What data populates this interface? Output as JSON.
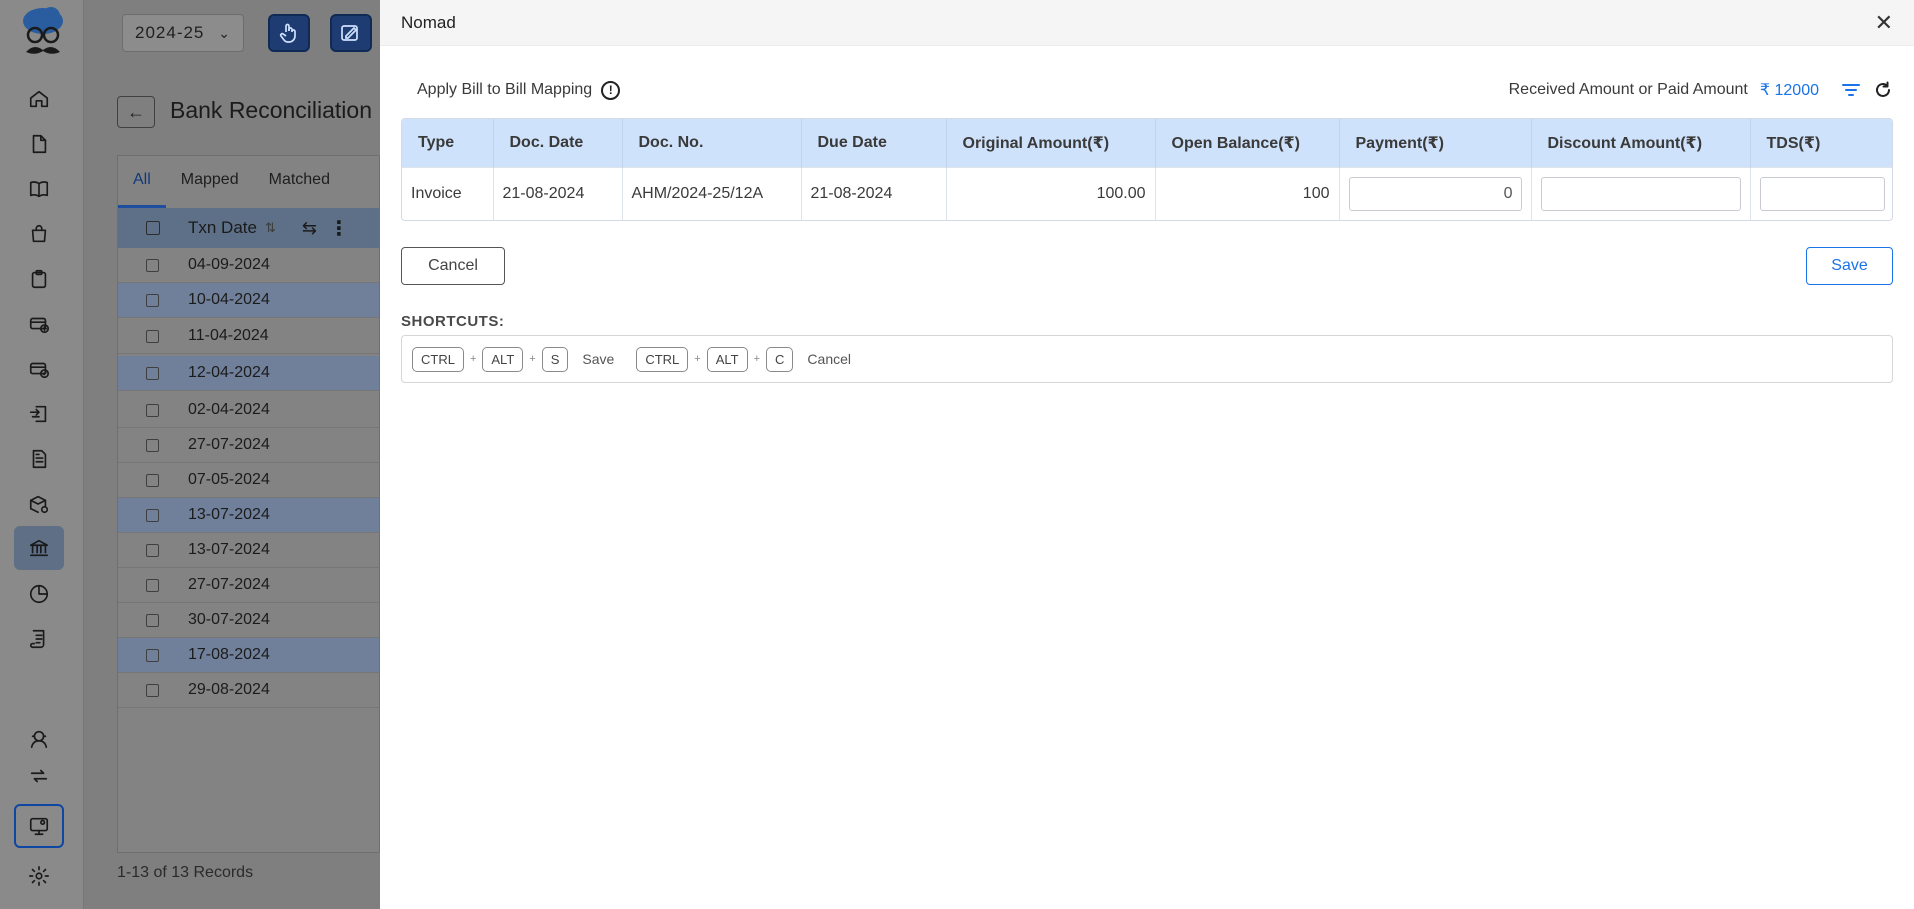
{
  "background": {
    "fiscal_year": "2024-25",
    "page_title": "Bank Reconciliation",
    "tabs": [
      "All",
      "Mapped",
      "Matched"
    ],
    "column_header": "Txn Date",
    "rows": [
      "04-09-2024",
      "10-04-2024",
      "11-04-2024",
      "12-04-2024",
      "02-04-2024",
      "27-07-2024",
      "07-05-2024",
      "13-07-2024",
      "13-07-2024",
      "27-07-2024",
      "30-07-2024",
      "17-08-2024",
      "29-08-2024"
    ],
    "records_label": "1-13 of 13 Records"
  },
  "sidebar": {
    "icons": [
      "home-icon",
      "document-icon",
      "book-icon",
      "shopping-bag-icon",
      "clipboard-icon",
      "card-add-icon",
      "card-check-icon",
      "receipt-exchange-icon",
      "file-text-icon",
      "box-gear-icon",
      "bank-icon",
      "pie-chart-icon",
      "ledger-icon",
      "support-agent-icon",
      "sync-icon",
      "monitor-icon",
      "settings-icon"
    ]
  },
  "drawer": {
    "title": "Nomad",
    "mapping_label": "Apply Bill to Bill Mapping",
    "info_symbol": "!",
    "amount_label": "Received Amount or Paid Amount",
    "amount_value": "₹ 12000",
    "table": {
      "headers": {
        "type": "Type",
        "doc_date": "Doc. Date",
        "doc_no": "Doc. No.",
        "due_date": "Due Date",
        "original_amount": "Original Amount(₹)",
        "open_balance": "Open Balance(₹)",
        "payment": "Payment(₹)",
        "discount": "Discount Amount(₹)",
        "tds": "TDS(₹)"
      },
      "row": {
        "type": "Invoice",
        "doc_date": "21-08-2024",
        "doc_no": "AHM/2024-25/12A",
        "due_date": "21-08-2024",
        "original_amount": "100.00",
        "open_balance": "100",
        "payment": "0",
        "discount": "",
        "tds": ""
      }
    },
    "cancel_label": "Cancel",
    "save_label": "Save",
    "shortcuts_title": "SHORTCUTS:",
    "shortcuts": {
      "save": {
        "keys": [
          "CTRL",
          "ALT",
          "S"
        ],
        "label": "Save"
      },
      "cancel": {
        "keys": [
          "CTRL",
          "ALT",
          "C"
        ],
        "label": "Cancel"
      }
    }
  }
}
